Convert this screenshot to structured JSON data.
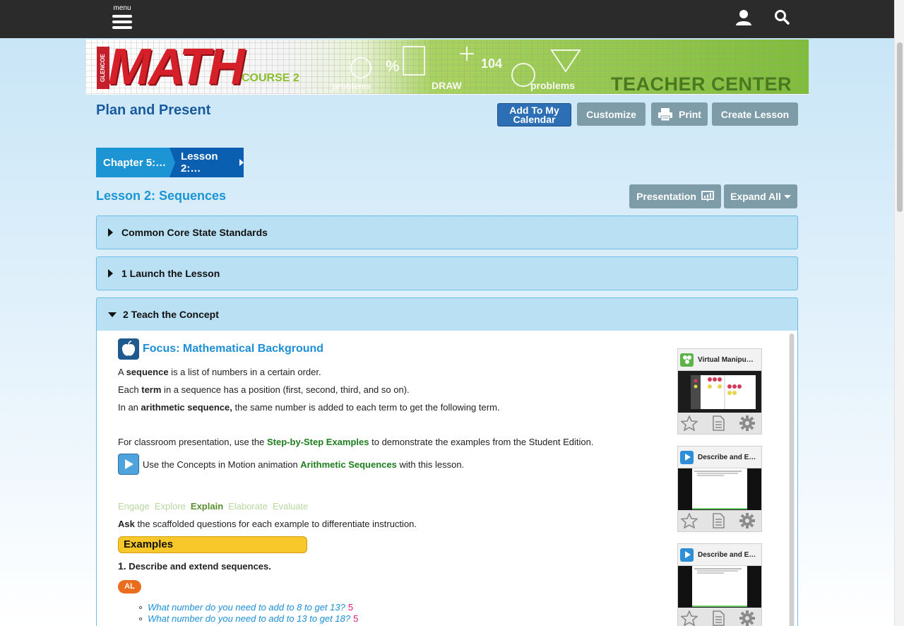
{
  "topbar": {
    "menu_label": "menu",
    "icons": [
      "menu-icon",
      "user-icon",
      "search-icon"
    ]
  },
  "banner": {
    "tab_text": "GLENCOE",
    "title": "MATH",
    "course": "COURSE 2",
    "center": "TEACHER CENTER"
  },
  "header": {
    "title": "Plan and Present",
    "buttons": {
      "calendar_line1": "Add To My",
      "calendar_line2": "Calendar",
      "customize": "Customize",
      "print": "Print",
      "create": "Create Lesson"
    }
  },
  "breadcrumb": {
    "chapter": "Chapter 5:…",
    "lesson": "Lesson 2:…"
  },
  "lesson": {
    "title": "Lesson 2: Sequences",
    "presentation": "Presentation",
    "expand_all": "Expand All"
  },
  "sections": [
    {
      "label": "Common Core State Standards",
      "expanded": false
    },
    {
      "label": "1 Launch the Lesson",
      "expanded": false
    },
    {
      "label": "2 Teach the Concept",
      "expanded": true
    }
  ],
  "teach": {
    "focus_title": "Focus: Mathematical Background",
    "p1_a": "A ",
    "p1_b": "sequence",
    "p1_c": " is a list of numbers in a certain order.",
    "p2_a": "Each ",
    "p2_b": "term",
    "p2_c": " in a sequence has a position (first, second, third, and so on).",
    "p3_a": "In an ",
    "p3_b": "arithmetic sequence,",
    "p3_c": " the same number is added to each term to get the following term.",
    "p4_a": "For classroom presentation, use the ",
    "p4_link": "Step-by-Step Examples",
    "p4_c": " to demonstrate the examples from the Student Edition.",
    "p5_a": "Use the Concepts in Motion animation ",
    "p5_link": "Arithmetic Sequences",
    "p5_c": " with this lesson.",
    "phases": [
      "Engage",
      "Explore",
      "Explain",
      "Elaborate",
      "Evaluate"
    ],
    "active_phase": "Explain",
    "ask_b": "Ask",
    "ask_c": " the scaffolded questions for each example to differentiate instruction.",
    "examples_label": "Examples",
    "example1_num": "1.",
    "example1_text": " Describe and extend sequences.",
    "level_badge": "AL",
    "questions": [
      {
        "text": "What number do you need to add to 8 to get 13?",
        "answer": "5"
      },
      {
        "text": "What number do you need to add to 13 to get 18?",
        "answer": "5"
      }
    ]
  },
  "resources": [
    {
      "title": "Virtual Manipu…",
      "icon": "manipulatives-icon"
    },
    {
      "title": "Describe and E…",
      "icon": "play-icon"
    },
    {
      "title": "Describe and E…",
      "icon": "play-icon"
    }
  ],
  "colors": {
    "topbar": "#2b2b2b",
    "title_blue": "#1a5b9e",
    "accent_blue": "#1d95d5",
    "accordion_bg": "#b9e0f3",
    "link_green": "#1e7d1e",
    "examples_yellow": "#f8c82a",
    "al_orange": "#e96d1d",
    "answer_pink": "#e0197d"
  }
}
